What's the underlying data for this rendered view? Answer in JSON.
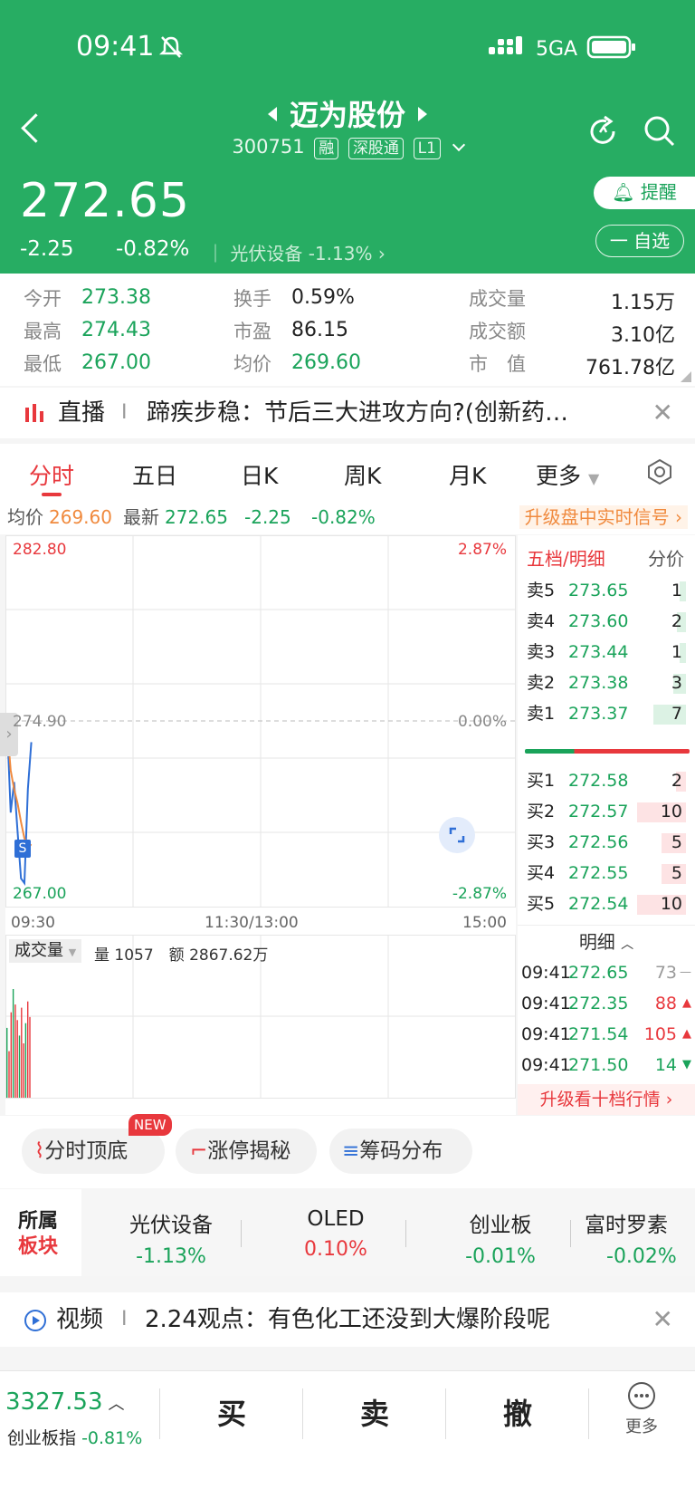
{
  "status_bar": {
    "time": "09:41",
    "network": "5GA"
  },
  "header": {
    "stock_name": "迈为股份",
    "code": "300751",
    "tags": [
      "融",
      "深股通",
      "L1"
    ],
    "price": "272.65",
    "change": "-2.25",
    "change_pct": "-0.82%",
    "sector_name": "光伏设备",
    "sector_change": "-1.13%",
    "remind_label": "提醒",
    "watch_label": "一 自选"
  },
  "stats": [
    {
      "label": "今开",
      "value": "273.38"
    },
    {
      "label": "换手",
      "value": "0.59%"
    },
    {
      "label": "成交量",
      "value": "1.15万"
    },
    {
      "label": "最高",
      "value": "274.43"
    },
    {
      "label": "市盈",
      "value": "86.15"
    },
    {
      "label": "成交额",
      "value": "3.10亿"
    },
    {
      "label": "最低",
      "value": "267.00"
    },
    {
      "label": "均价",
      "value": "269.60"
    },
    {
      "label": "市　值",
      "value": "761.78亿"
    }
  ],
  "live": {
    "tag": "直播",
    "sep": "I",
    "text": "蹄疾步稳：节后三大进攻方向?(创新药…"
  },
  "tabs": [
    "分时",
    "五日",
    "日K",
    "周K",
    "月K",
    "更多"
  ],
  "info_bar": {
    "avg_label": "均价",
    "avg": "269.60",
    "latest_label": "最新",
    "latest": "272.65",
    "change": "-2.25",
    "change_pct": "-0.82%",
    "upgrade": "升级盘中实时信号"
  },
  "chart": {
    "high_price": "282.80",
    "high_pct": "2.87%",
    "mid_price": "274.90",
    "mid_pct": "0.00%",
    "low_price": "267.00",
    "low_pct": "-2.87%",
    "t_start": "09:30",
    "t_mid": "11:30/13:00",
    "t_end": "15:00",
    "vol_label": "成交量",
    "vol_qty_label": "量",
    "vol_qty": "1057",
    "vol_amt_label": "额",
    "vol_amt": "2867.62万",
    "marker": "S"
  },
  "chart_data": {
    "type": "line",
    "title": "",
    "x": [
      "09:30",
      "09:31",
      "09:32",
      "09:33",
      "09:34",
      "09:35",
      "09:36",
      "09:37"
    ],
    "series": [
      {
        "name": "最新",
        "values": [
          274.6,
          271.0,
          272.3,
          270.2,
          268.2,
          268.0,
          272.0,
          274.0
        ]
      },
      {
        "name": "均价",
        "values": [
          274.6,
          272.8,
          272.0,
          271.4,
          270.6,
          269.9,
          269.7,
          269.6
        ]
      }
    ],
    "ylim": [
      267.0,
      282.8
    ],
    "volume": [
      45,
      30,
      55,
      70,
      60,
      50,
      40,
      58,
      35,
      48,
      62,
      52
    ],
    "grid": true
  },
  "orderbook": {
    "title": "五档/明细",
    "alt": "分价",
    "asks": [
      {
        "label": "卖5",
        "price": "273.65",
        "qty": "1",
        "w": 0.12
      },
      {
        "label": "卖4",
        "price": "273.60",
        "qty": "2",
        "w": 0.18
      },
      {
        "label": "卖3",
        "price": "273.44",
        "qty": "1",
        "w": 0.12
      },
      {
        "label": "卖2",
        "price": "273.38",
        "qty": "3",
        "w": 0.25
      },
      {
        "label": "卖1",
        "price": "273.37",
        "qty": "7",
        "w": 0.65
      }
    ],
    "bids": [
      {
        "label": "买1",
        "price": "272.58",
        "qty": "2",
        "w": 0.18
      },
      {
        "label": "买2",
        "price": "272.57",
        "qty": "10",
        "w": 0.9
      },
      {
        "label": "买3",
        "price": "272.56",
        "qty": "5",
        "w": 0.45
      },
      {
        "label": "买4",
        "price": "272.55",
        "qty": "5",
        "w": 0.45
      },
      {
        "label": "买5",
        "price": "272.54",
        "qty": "10",
        "w": 0.9
      }
    ],
    "detail_title": "明细",
    "trades": [
      {
        "time": "09:41",
        "price": "272.65",
        "qty": "73"
      },
      {
        "time": "09:41",
        "price": "272.35",
        "qty": "88"
      },
      {
        "time": "09:41",
        "price": "271.54",
        "qty": "105"
      },
      {
        "time": "09:41",
        "price": "271.50",
        "qty": "14"
      }
    ],
    "upgrade": "升级看十档行情"
  },
  "functions": [
    {
      "label": "分时顶底",
      "badge": "NEW"
    },
    {
      "label": "涨停揭秘"
    },
    {
      "label": "筹码分布"
    }
  ],
  "sectors": {
    "title1": "所属",
    "title2": "板块",
    "items": [
      {
        "name": "光伏设备",
        "change": "-1.13%"
      },
      {
        "name": "OLED",
        "change": "0.10%"
      },
      {
        "name": "创业板",
        "change": "-0.01%"
      },
      {
        "name": "富时罗素",
        "change": "-0.02%"
      }
    ]
  },
  "video": {
    "tag": "视频",
    "sep": "I",
    "text": "2.24观点：有色化工还没到大爆阶段呢"
  },
  "bottom": {
    "index_value": "3327.53",
    "index_name": "创业板指",
    "index_change": "-0.81%",
    "buy": "买",
    "sell": "卖",
    "cancel": "撤",
    "more": "更多"
  },
  "colors": {
    "green": "#1aa35a",
    "header": "#27ad63",
    "red": "#e8383d",
    "price_line": "#2f6fd6",
    "avg_line": "#f08a3e"
  }
}
